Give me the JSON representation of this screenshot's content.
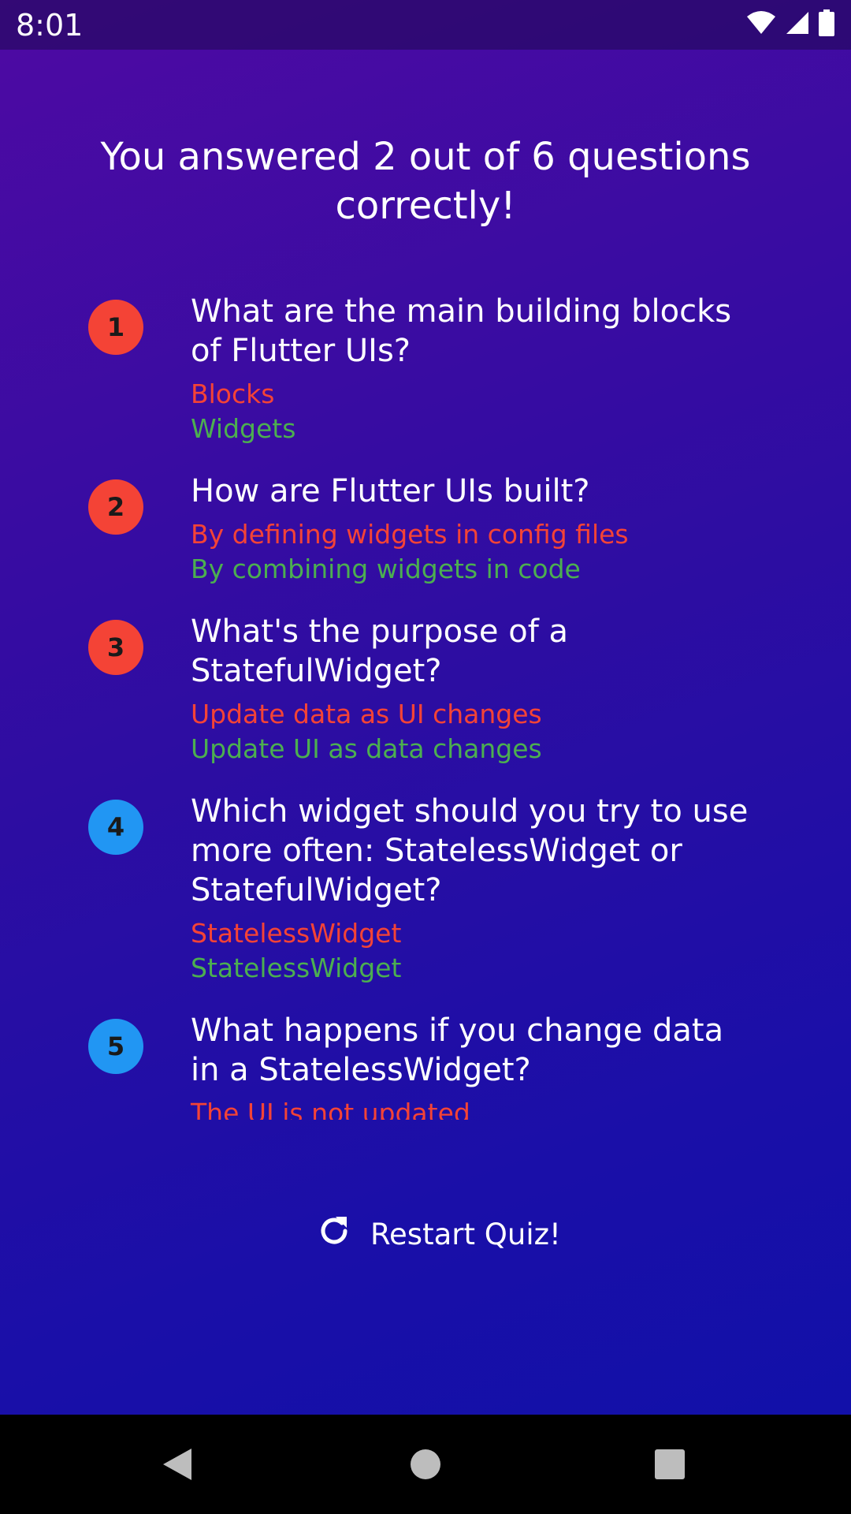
{
  "status_bar": {
    "time": "8:01",
    "icons": [
      "wifi-icon",
      "signal-icon",
      "battery-icon"
    ]
  },
  "results": {
    "headline": "You answered 2 out of 6 questions correctly!"
  },
  "summary": [
    {
      "index": "1",
      "question": "What are the main building blocks of Flutter UIs?",
      "user_answer": "Blocks",
      "correct_answer": "Widgets",
      "is_correct": false
    },
    {
      "index": "2",
      "question": "How are Flutter UIs built?",
      "user_answer": "By defining widgets in config files",
      "correct_answer": "By combining widgets in code",
      "is_correct": false
    },
    {
      "index": "3",
      "question": "What's the purpose of a StatefulWidget?",
      "user_answer": "Update data as UI changes",
      "correct_answer": "Update UI as data changes",
      "is_correct": false
    },
    {
      "index": "4",
      "question": "Which widget should you try to use more often: StatelessWidget or StatefulWidget?",
      "user_answer": "StatelessWidget",
      "correct_answer": "StatelessWidget",
      "is_correct": true
    },
    {
      "index": "5",
      "question": "What happens if you change data in a StatelessWidget?",
      "user_answer": "The UI is not updated",
      "correct_answer": "",
      "is_correct": true
    }
  ],
  "restart": {
    "label": "Restart Quiz!",
    "icon": "restart-icon"
  },
  "colors": {
    "wrong": "#f44336",
    "right": "#2196f3",
    "correct_text": "#4caf50",
    "user_text": "#f44336"
  },
  "nav_bar": {
    "icons": [
      "back-icon",
      "home-icon",
      "recents-icon"
    ]
  }
}
